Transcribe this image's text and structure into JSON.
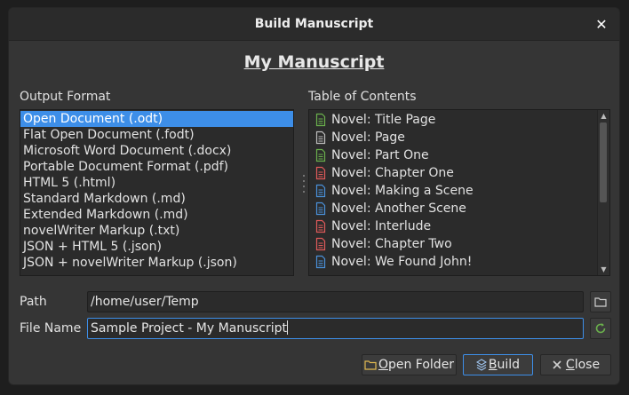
{
  "window": {
    "title": "Build Manuscript"
  },
  "heading": "My Manuscript",
  "output_format": {
    "label": "Output Format",
    "items": [
      "Open Document (.odt)",
      "Flat Open Document (.fodt)",
      "Microsoft Word Document (.docx)",
      "Portable Document Format (.pdf)",
      "HTML 5 (.html)",
      "Standard Markdown (.md)",
      "Extended Markdown (.md)",
      "novelWriter Markup (.txt)",
      "JSON + HTML 5 (.json)",
      "JSON + novelWriter Markup (.json)"
    ],
    "selected_index": 0
  },
  "toc": {
    "label": "Table of Contents",
    "items": [
      {
        "text": "Novel: Title Page",
        "icon": "document-icon",
        "color": "#6ab04c"
      },
      {
        "text": "Novel: Page",
        "icon": "document-icon",
        "color": "#bdbdbd"
      },
      {
        "text": "Novel: Part One",
        "icon": "document-icon",
        "color": "#6ab04c"
      },
      {
        "text": "Novel: Chapter One",
        "icon": "document-icon",
        "color": "#e05a5a"
      },
      {
        "text": "Novel: Making a Scene",
        "icon": "document-icon",
        "color": "#4a90d9"
      },
      {
        "text": "Novel: Another Scene",
        "icon": "document-icon",
        "color": "#4a90d9"
      },
      {
        "text": "Novel: Interlude",
        "icon": "document-icon",
        "color": "#e05a5a"
      },
      {
        "text": "Novel: Chapter Two",
        "icon": "document-icon",
        "color": "#e05a5a"
      },
      {
        "text": "Novel: We Found John!",
        "icon": "document-icon",
        "color": "#4a90d9"
      }
    ]
  },
  "path": {
    "label": "Path",
    "value": "/home/user/Temp"
  },
  "file_name": {
    "label": "File Name",
    "value": "Sample Project - My Manuscript"
  },
  "buttons": {
    "open_folder": {
      "first": "O",
      "rest": "pen Folder"
    },
    "build": {
      "first": "B",
      "rest": "uild"
    },
    "close": {
      "first": "C",
      "rest": "lose"
    }
  },
  "colors": {
    "accent": "#3d8ee8",
    "background": "#353535"
  }
}
